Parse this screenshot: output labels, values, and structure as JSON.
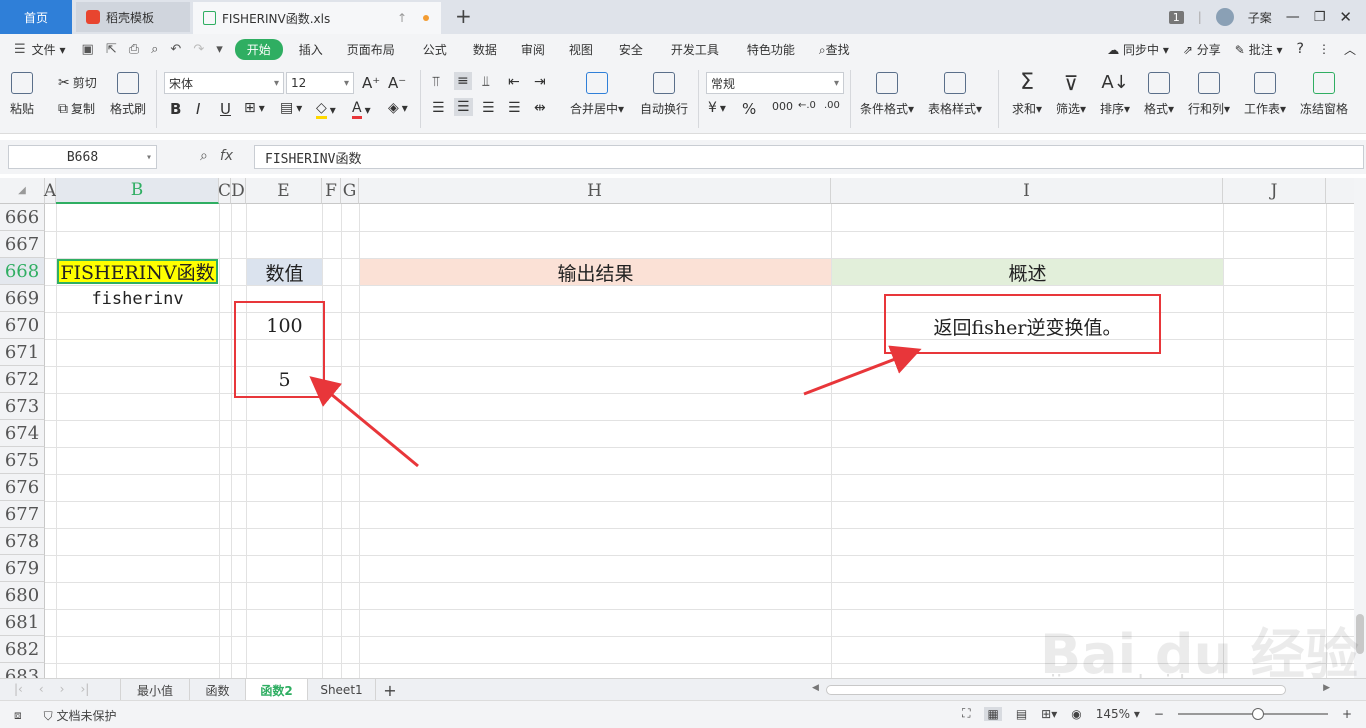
{
  "titlebar": {
    "home_tab": "首页",
    "template_tab": "稻壳模板",
    "file_tab": "FISHERINV函数.xls",
    "window_count": "1",
    "user": "子案"
  },
  "menu": {
    "file": "文件",
    "items": [
      "开始",
      "插入",
      "页面布局",
      "公式",
      "数据",
      "审阅",
      "视图",
      "安全",
      "开发工具",
      "特色功能"
    ],
    "search": "查找",
    "sync": "同步中",
    "share": "分享",
    "annotate": "批注"
  },
  "ribbon": {
    "paste": "粘贴",
    "cut": "剪切",
    "copy": "复制",
    "format_painter": "格式刷",
    "font_name": "宋体",
    "font_size": "12",
    "merge_center": "合并居中",
    "wrap_text": "自动换行",
    "number_format": "常规",
    "conditional_format": "条件格式",
    "table_style": "表格样式",
    "sum": "求和",
    "filter": "筛选",
    "sort": "排序",
    "format": "格式",
    "row_col": "行和列",
    "worksheet": "工作表",
    "freeze": "冻结窗格"
  },
  "formula_bar": {
    "name_box": "B668",
    "formula": "FISHERINV函数"
  },
  "columns": [
    "A",
    "B",
    "C",
    "D",
    "E",
    "F",
    "G",
    "H",
    "I",
    "J"
  ],
  "rows": [
    "666",
    "667",
    "668",
    "669",
    "670",
    "671",
    "672",
    "673",
    "674",
    "675",
    "676",
    "677",
    "678",
    "679",
    "680",
    "681",
    "682",
    "683"
  ],
  "cells": {
    "b668": "FISHERINV函数",
    "b669": "fisherinv",
    "e668": "数值",
    "e670": "100",
    "e672": "5",
    "h668": "输出结果",
    "i668": "概述",
    "i670": "返回fisher逆变换值。"
  },
  "sheets": [
    "最小值",
    "函数",
    "函数2",
    "Sheet1"
  ],
  "active_sheet": "函数2",
  "status": {
    "protect": "文档未保护",
    "zoom": "145%"
  },
  "colors": {
    "accent": "#2fae62",
    "highlight_yellow": "#ffff00",
    "header_blue": "#dbe3ee",
    "header_salmon": "#fbe1d6",
    "header_green": "#e2efda",
    "annotation_red": "#e8363a"
  }
}
